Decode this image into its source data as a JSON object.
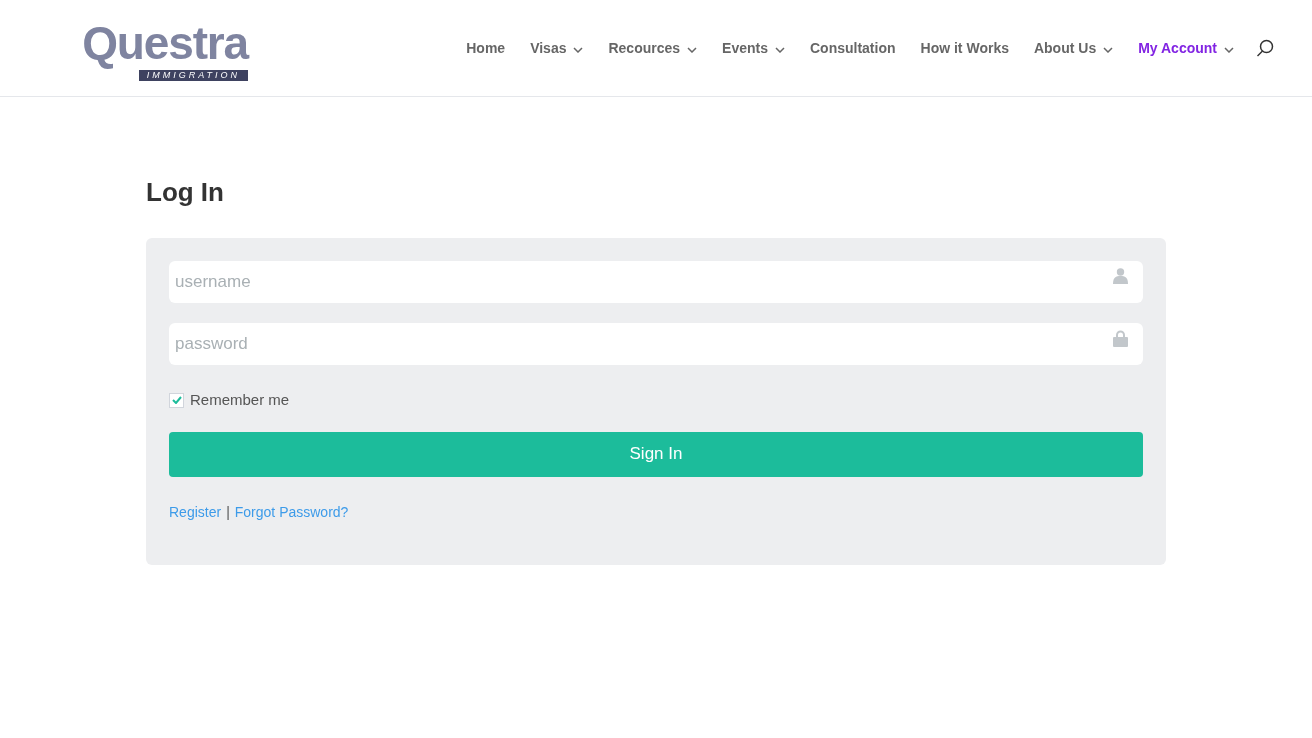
{
  "logo": {
    "name": "Questra",
    "tagline": "IMMIGRATION"
  },
  "nav": [
    {
      "label": "Home",
      "dropdown": false,
      "selected": false
    },
    {
      "label": "Visas",
      "dropdown": true,
      "selected": false
    },
    {
      "label": "Recources",
      "dropdown": true,
      "selected": false
    },
    {
      "label": "Events",
      "dropdown": true,
      "selected": false
    },
    {
      "label": "Consultation",
      "dropdown": false,
      "selected": false
    },
    {
      "label": "How it Works",
      "dropdown": false,
      "selected": false
    },
    {
      "label": "About Us",
      "dropdown": true,
      "selected": false
    },
    {
      "label": "My Account",
      "dropdown": true,
      "selected": true
    }
  ],
  "heading": "Log In",
  "fields": [
    {
      "kind": "user",
      "placeholder": "username"
    },
    {
      "kind": "lock",
      "placeholder": "password"
    }
  ],
  "remember": {
    "label": "Remember me",
    "checked": true
  },
  "submit": "Sign In",
  "links": [
    "Register",
    "|",
    "Forgot Password?"
  ]
}
